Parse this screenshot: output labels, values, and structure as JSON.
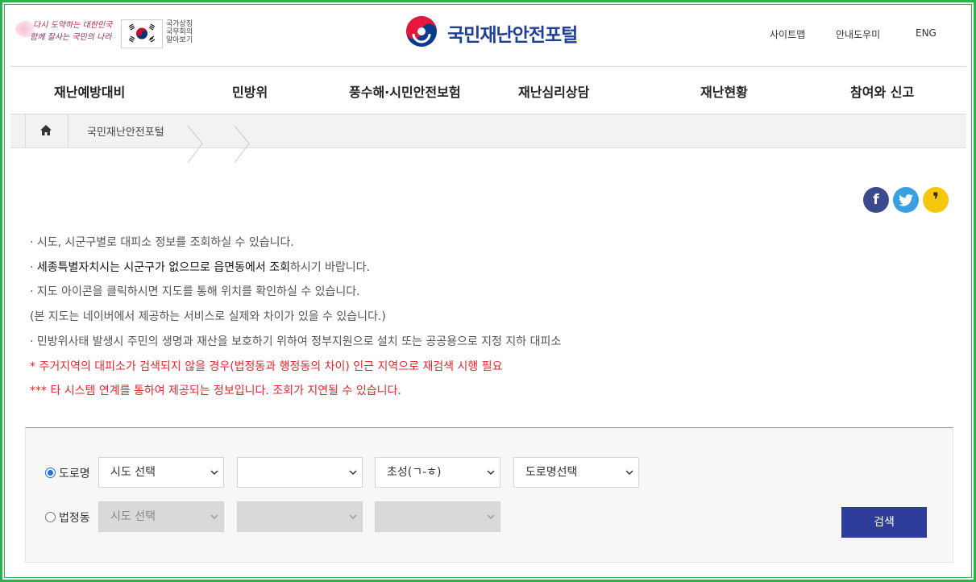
{
  "header": {
    "slogan_line1": "다시 도약하는 대한민국",
    "slogan_line2": "함께 잘사는 국민의 나라",
    "symbols_text": "국가상징 국무회의 알아보기",
    "site_title": "국민재난안전포털",
    "util_links": [
      "사이트맵",
      "안내도우미",
      "ENG"
    ]
  },
  "nav": {
    "items": [
      "재난예방대비",
      "민방위",
      "풍수해·시민안전보험",
      "재난심리상담",
      "재난현황",
      "참여와 신고"
    ]
  },
  "breadcrumb": {
    "current": "국민재난안전포털"
  },
  "social": {
    "facebook": "f",
    "twitter": "t",
    "kakao": "❜"
  },
  "notices": {
    "line1": "· 시도, 시군구별로 대피소 정보를 조회하실 수 있습니다.",
    "line2_prefix": "· ",
    "line2_bold": "세종특별자치시는 시군구가 없으므로 읍면동에서 조회",
    "line2_suffix": "하시기 바랍니다.",
    "line3": "· 지도 아이콘을 클릭하시면 지도를 통해 위치를 확인하실 수 있습니다.",
    "line4": "(본 지도는 네이버에서 제공하는 서비스로 실제와 차이가 있을 수 있습니다.)",
    "line5": "· 민방위사태 발생시 주민의 생명과 재산을 보호하기 위하여 정부지원으로 설치 또는 공공용으로 지정 지하 대피소",
    "line6": "* 주거지역의 대피소가 검색되지 않을 경우(법정동과 행정동의 차이) 인근 지역으로 재검색 시행 필요",
    "line7": "*** 타 시스템 연계를 통하여 제공되는 정보입니다. 조회가 지연될 수 있습니다."
  },
  "search": {
    "road_label": "도로명",
    "legal_label": "법정동",
    "road_selects": [
      "시도 선택",
      "",
      "초성(ㄱ-ㅎ)",
      "도로명선택"
    ],
    "legal_selects": [
      "시도 선택",
      "",
      ""
    ],
    "search_button": "검색"
  },
  "colors": {
    "accent": "#2d3b9a",
    "warning": "#e8262b",
    "frame": "#2bb24c"
  }
}
